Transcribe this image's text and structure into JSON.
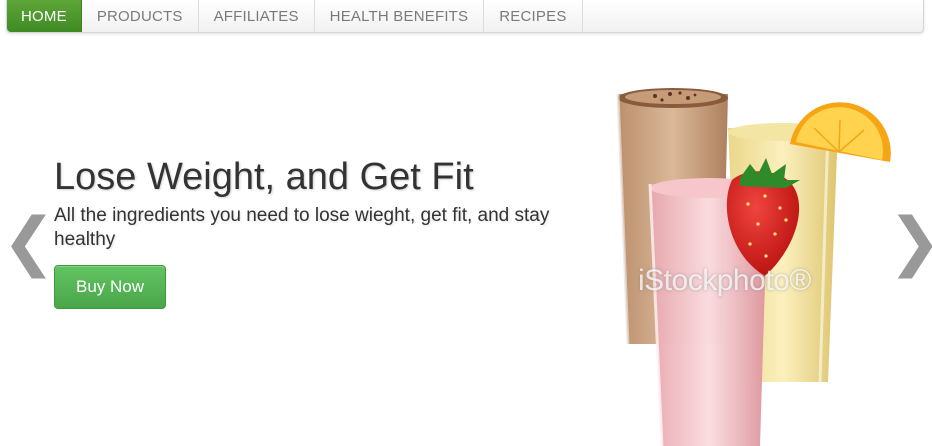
{
  "nav": {
    "items": [
      {
        "label": "HOME",
        "active": true
      },
      {
        "label": "PRODUCTS",
        "active": false
      },
      {
        "label": "AFFILIATES",
        "active": false
      },
      {
        "label": "HEALTH BENEFITS",
        "active": false
      },
      {
        "label": "RECIPES",
        "active": false
      }
    ]
  },
  "hero": {
    "headline": "Lose Weight, and Get Fit",
    "lead": "All the ingredients you need to lose wieght, get fit, and stay healthy",
    "button_label": "Buy Now",
    "prev_arrow": "❮",
    "next_arrow": "❯",
    "watermark": "iStockphoto®"
  },
  "colors": {
    "nav_active_bg": "#4f9a2e",
    "button_bg": "#57b457",
    "text": "#333333",
    "arrow": "#888888"
  },
  "icons": {
    "prev": "chevron-left-icon",
    "next": "chevron-right-icon"
  }
}
